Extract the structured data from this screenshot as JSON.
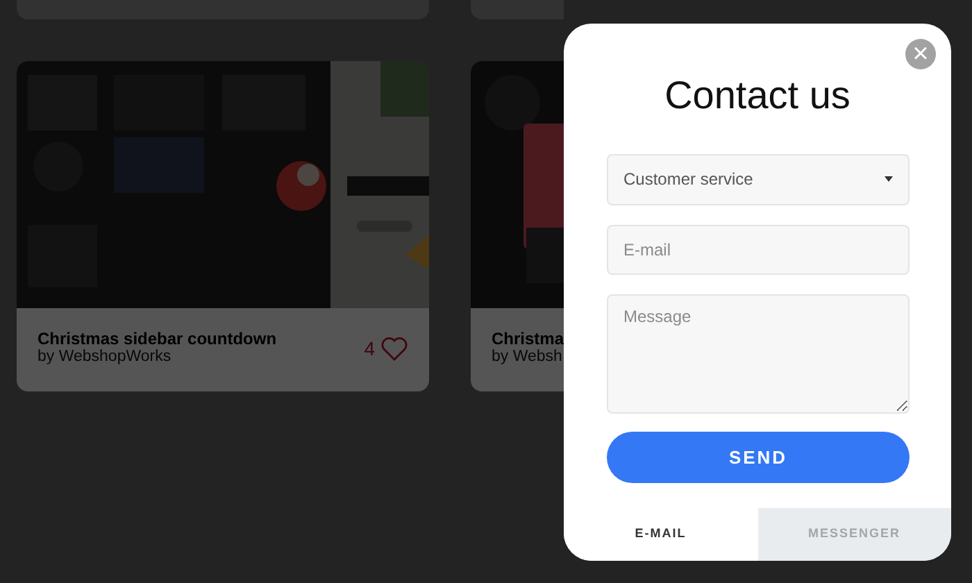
{
  "cards": [
    {
      "kind": "picture",
      "title": "Christmas sidebar countdown",
      "author": "by WebshopWorks",
      "likes": "4",
      "liked": false
    },
    {
      "kind": "picture",
      "title": "Christma",
      "author": "by Websh"
    }
  ],
  "modal": {
    "title": "Contact us",
    "close": "×",
    "select": {
      "value": "Customer service"
    },
    "email": {
      "placeholder": "E-mail"
    },
    "message": {
      "placeholder": "Message"
    },
    "button": "SEND",
    "tabs": [
      {
        "label": "E-MAIL",
        "selected": true
      },
      {
        "label": "MESSENGER",
        "selected": false
      }
    ]
  }
}
